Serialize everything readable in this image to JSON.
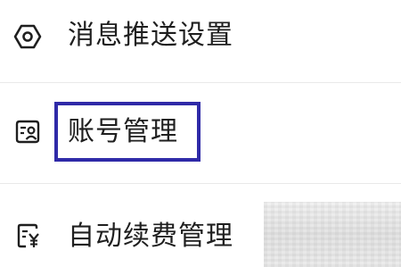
{
  "menu": {
    "items": [
      {
        "label": "消息推送设置",
        "icon": "settings-hex-icon"
      },
      {
        "label": "账号管理",
        "icon": "account-card-icon"
      },
      {
        "label": "自动续费管理",
        "icon": "renewal-billing-icon"
      }
    ]
  },
  "colors": {
    "text": "#1f1f1f",
    "highlight_border": "#2f2aa8",
    "divider": "#e9e9e9"
  }
}
